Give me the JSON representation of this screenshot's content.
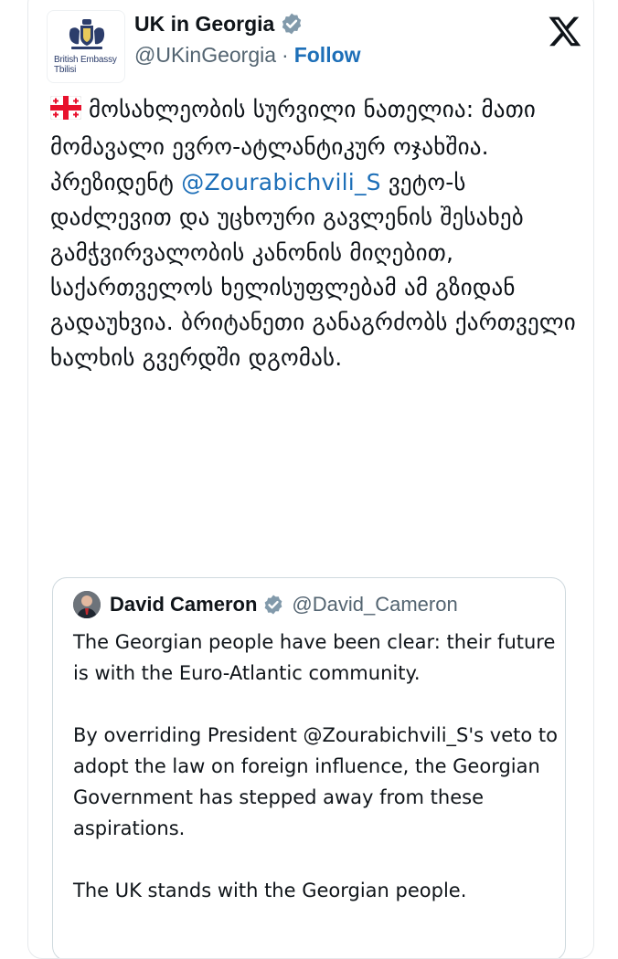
{
  "account": {
    "display_name": "UK in Georgia",
    "handle": "@UKinGeorgia",
    "separator": "·",
    "follow_label": "Follow",
    "avatar_caption_line1": "British Embassy",
    "avatar_caption_line2": "Tbilisi"
  },
  "tweet": {
    "part1": "მოსახლეობის სურვილი ნათელია: მათი მომავალი ევრო-ატლანტიკურ ოჯახშია. პრეზიდენტ ",
    "mention": "@Zourabichvili_S",
    "part2": " ვეტო-ს დაძლევით და უცხოური გავლენის შესახებ გამჭვირვალობის კანონის მიღებით, საქართველოს ხელისუფლებამ ამ გზიდან გადაუხვია. ბრიტანეთი განაგრძობს ქართველი ხალხის გვერდში დგომას."
  },
  "quoted": {
    "display_name": "David Cameron",
    "handle": "@David_Cameron",
    "text": "The Georgian people have been clear: their future is with the Euro-Atlantic community.\n\nBy overriding President @Zourabichvili_S's veto to adopt the law on foreign influence, the Georgian Government has stepped away from these aspirations.\n\nThe UK stands with the Georgian people."
  },
  "icons": {
    "verified": "verified-badge-icon",
    "platform": "x-logo-icon",
    "flag": "georgia-flag-icon",
    "crest": "royal-crest-icon"
  },
  "colors": {
    "link": "#1d6fb8",
    "secondary_text": "#536471",
    "verified_badge": "#829aab",
    "border": "#cfd9de"
  }
}
